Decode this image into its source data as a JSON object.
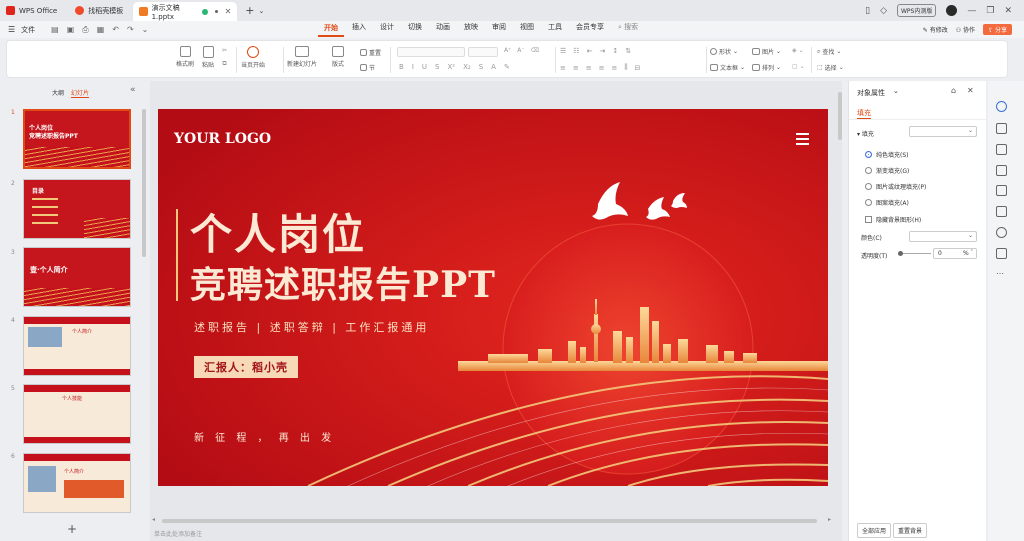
{
  "window": {
    "tabs": [
      {
        "label": "WPS Office"
      },
      {
        "label": "找稻壳模板"
      },
      {
        "label": "演示文稿1.pptx"
      }
    ],
    "user_badge": "WPS内测版",
    "share_label": "分享",
    "collab_label": "协作",
    "edit_label": "有修改"
  },
  "menu": {
    "file": "文件",
    "items": [
      "开始",
      "插入",
      "设计",
      "切换",
      "动画",
      "放映",
      "审阅",
      "视图",
      "工具",
      "会员专享"
    ],
    "search": "搜索"
  },
  "ribbon": {
    "format_painter": "格式刷",
    "paste": "粘贴",
    "play_from_current": "当页开始",
    "new_slide": "新建幻灯片",
    "layout": "版式",
    "reset": "重置",
    "section": "节",
    "shape": "形状",
    "picture": "图片",
    "textbox": "文本框",
    "arrange": "排列",
    "find": "查找",
    "select": "选择"
  },
  "left_panel": {
    "tab_outline": "大纲",
    "tab_slides": "幻灯片",
    "slides": [
      {
        "num": "1",
        "title": "个人岗位\n竞聘述职报告PPT"
      },
      {
        "num": "2",
        "title": "目录"
      },
      {
        "num": "3",
        "title": "壹·个人简介"
      },
      {
        "num": "4",
        "title": "个人简介"
      },
      {
        "num": "5",
        "title": "个人技能"
      },
      {
        "num": "6",
        "title": "个人简介"
      }
    ]
  },
  "slide": {
    "logo": "YOUR LOGO",
    "title_line1": "个人岗位",
    "title_line2": "竞聘述职报告PPT",
    "subtitle": "述职报告 | 述职答辩 | 工作汇报通用",
    "reporter": "汇报人：稻小壳",
    "slogan": "新  征  程  ，  再  出  发"
  },
  "notes_placeholder": "单击此处添加备注",
  "right_panel": {
    "title": "对象属性",
    "tab_fill": "填充",
    "section_fill": "填充",
    "options": [
      "纯色填充(S)",
      "渐变填充(G)",
      "图片或纹理填充(P)",
      "图案填充(A)"
    ],
    "selected_option": "纯色填充(S)",
    "hide_bg": "隐藏背景图形(H)",
    "color_label": "颜色(C)",
    "transparency_label": "透明度(T)",
    "transparency_value": "0",
    "transparency_unit": "%",
    "apply_all": "全部应用",
    "reset_bg": "重置背景"
  },
  "colors": {
    "accent": "#e04a14",
    "slide_red": "#c4111b",
    "gold": "#f3c87a"
  }
}
